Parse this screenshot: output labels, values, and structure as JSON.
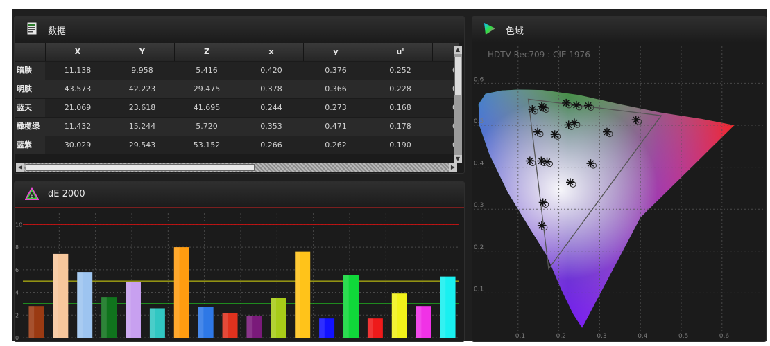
{
  "data_panel": {
    "title": "数据",
    "columns": [
      "X",
      "Y",
      "Z",
      "x",
      "y",
      "u'"
    ],
    "rows": [
      {
        "label": "暗肤",
        "values": [
          "11.138",
          "9.958",
          "5.416",
          "0.420",
          "0.376",
          "0.252",
          "0"
        ]
      },
      {
        "label": "明肤",
        "values": [
          "43.573",
          "42.223",
          "29.475",
          "0.378",
          "0.366",
          "0.228",
          "0"
        ]
      },
      {
        "label": "蓝天",
        "values": [
          "21.069",
          "23.618",
          "41.695",
          "0.244",
          "0.273",
          "0.168",
          "0"
        ]
      },
      {
        "label": "橄榄绿",
        "values": [
          "11.432",
          "15.244",
          "5.720",
          "0.353",
          "0.471",
          "0.178",
          "0"
        ]
      },
      {
        "label": "蓝紫",
        "values": [
          "30.029",
          "29.543",
          "53.152",
          "0.266",
          "0.262",
          "0.190",
          "0"
        ]
      }
    ],
    "scroll_up": "▲",
    "scroll_down": "▼",
    "scroll_left": "◀",
    "scroll_right": "▶"
  },
  "de_panel": {
    "title": "dE 2000",
    "icon_letter": "E"
  },
  "gamut_panel": {
    "title": "色域"
  },
  "chart_data": [
    {
      "type": "bar",
      "title": "dE 2000",
      "ylim": [
        0,
        11
      ],
      "yticks": [
        "0",
        "2",
        "4",
        "6",
        "8",
        "10"
      ],
      "reference_lines": [
        {
          "value": 10,
          "color": "#cc1111"
        },
        {
          "value": 5,
          "color": "#d9d90f"
        },
        {
          "value": 3,
          "color": "#22cc22"
        }
      ],
      "values": [
        2.8,
        7.4,
        5.8,
        3.6,
        4.9,
        2.6,
        8.0,
        2.7,
        2.2,
        1.9,
        3.5,
        7.6,
        1.7,
        5.5,
        1.7,
        3.9,
        2.8,
        5.4
      ],
      "colors": [
        "#9a3a12",
        "#f7c79c",
        "#9dc4f0",
        "#10731d",
        "#c8a0f0",
        "#31c7c2",
        "#ff9c10",
        "#2e78e6",
        "#e0321e",
        "#7a1a7a",
        "#a8cc18",
        "#ffc31a",
        "#1212ff",
        "#10d83a",
        "#ee1a1a",
        "#f2f21a",
        "#f032e6",
        "#19f0f0"
      ],
      "grid": true
    },
    {
      "type": "scatter",
      "subtitle": "HDTV Rec709 : CIE 1976",
      "xlim": [
        0,
        0.7
      ],
      "ylim": [
        0,
        0.65
      ],
      "xticks": [
        "0.1",
        "0.2",
        "0.3",
        "0.4",
        "0.5",
        "0.6"
      ],
      "yticks": [
        "0.1",
        "0.2",
        "0.3",
        "0.4",
        "0.5",
        "0.6"
      ],
      "grid": true,
      "gamut_triangle": [
        [
          0.451,
          0.523
        ],
        [
          0.125,
          0.562
        ],
        [
          0.175,
          0.158
        ]
      ],
      "measured_points": [
        [
          0.135,
          0.538
        ],
        [
          0.162,
          0.542
        ],
        [
          0.218,
          0.553
        ],
        [
          0.243,
          0.548
        ],
        [
          0.272,
          0.547
        ],
        [
          0.158,
          0.545
        ],
        [
          0.148,
          0.484
        ],
        [
          0.19,
          0.478
        ],
        [
          0.224,
          0.501
        ],
        [
          0.238,
          0.506
        ],
        [
          0.318,
          0.484
        ],
        [
          0.389,
          0.513
        ],
        [
          0.129,
          0.415
        ],
        [
          0.157,
          0.415
        ],
        [
          0.171,
          0.413
        ],
        [
          0.278,
          0.409
        ],
        [
          0.228,
          0.364
        ],
        [
          0.161,
          0.316
        ],
        [
          0.158,
          0.261
        ]
      ]
    }
  ]
}
